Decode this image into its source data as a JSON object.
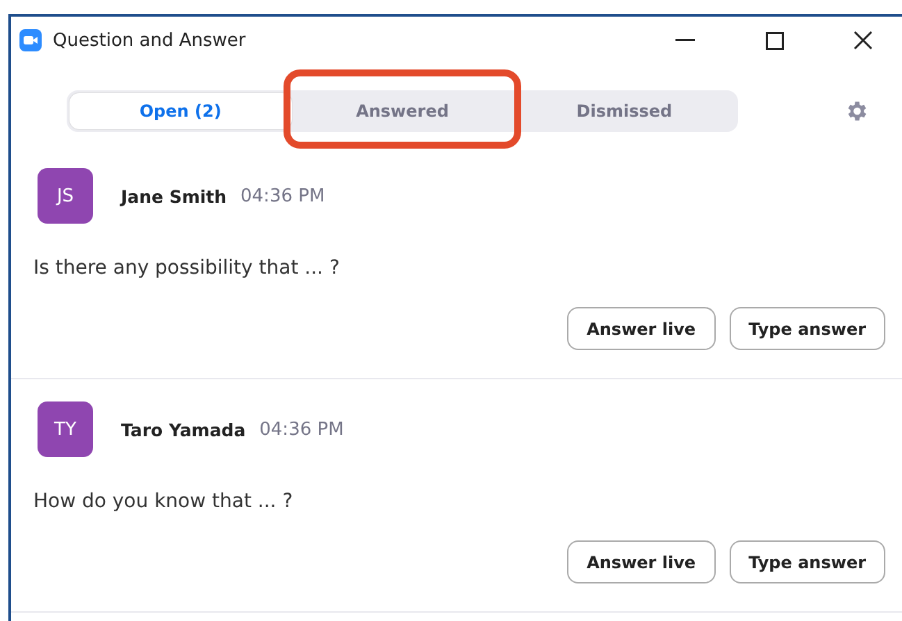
{
  "window": {
    "title": "Question and Answer"
  },
  "tabs": [
    {
      "label": "Open (2)",
      "selected": true,
      "highlighted": false
    },
    {
      "label": "Answered",
      "selected": false,
      "highlighted": true
    },
    {
      "label": "Dismissed",
      "selected": false,
      "highlighted": false
    }
  ],
  "questions": [
    {
      "initials": "JS",
      "color": "#8f46b0",
      "name": "Jane Smith",
      "time": "04:36 PM",
      "text": "Is there any possibility that ... ?",
      "buttons": [
        "Answer live",
        "Type answer"
      ]
    },
    {
      "initials": "TY",
      "color": "#8f46b0",
      "name": "Taro Yamada",
      "time": "04:36 PM",
      "text": "How do you know that ... ?",
      "buttons": [
        "Answer live",
        "Type answer"
      ]
    }
  ]
}
